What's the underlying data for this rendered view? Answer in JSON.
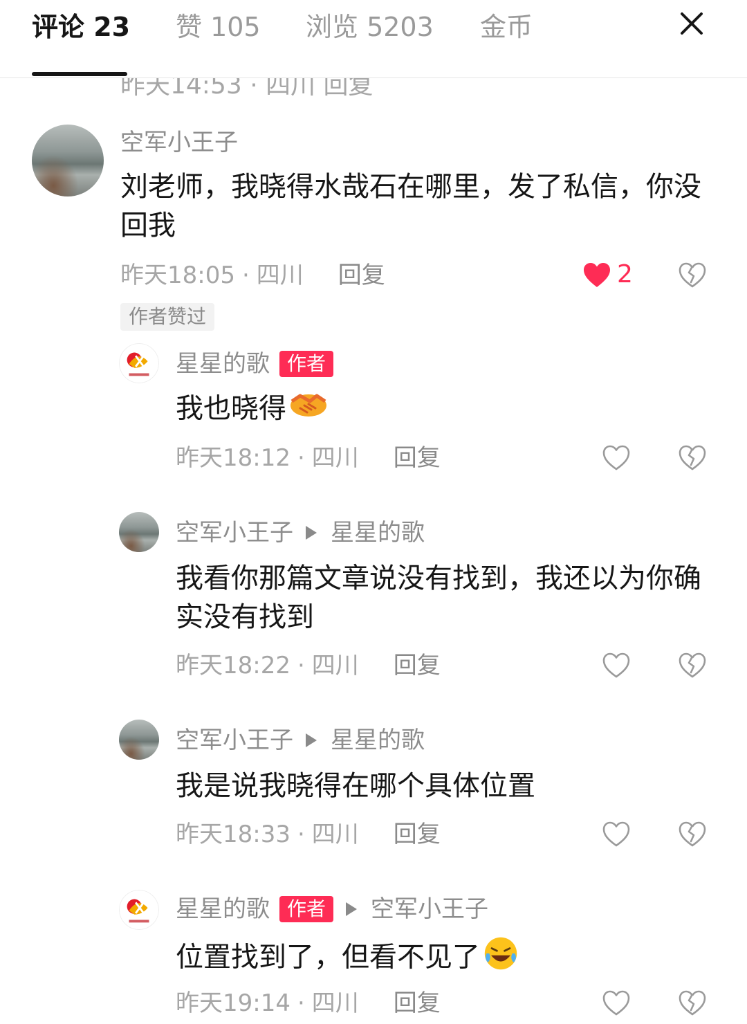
{
  "header": {
    "tabs": [
      {
        "label": "评论 23"
      },
      {
        "label": "赞 105"
      },
      {
        "label": "浏览 5203"
      },
      {
        "label": "金币"
      }
    ]
  },
  "previous_meta": "昨天14:53 · 四川 回复",
  "comments": [
    {
      "user": "空军小王子",
      "text": "刘老师，我晓得水哉石在哪里，发了私信，你没回我",
      "time": "昨天18:05",
      "location": "四川",
      "reply_label": "回复",
      "like_count": "2",
      "author_liked_tag": "作者赞过"
    },
    {
      "user": "星星的歌",
      "badge": "作者",
      "text": "我也晓得",
      "emoji": "handshake",
      "time": "昨天18:12",
      "location": "四川",
      "reply_label": "回复"
    },
    {
      "user": "空军小王子",
      "reply_to": "星星的歌",
      "text": "我看你那篇文章说没有找到，我还以为你确实没有找到",
      "time": "昨天18:22",
      "location": "四川",
      "reply_label": "回复"
    },
    {
      "user": "空军小王子",
      "reply_to": "星星的歌",
      "text": "我是说我晓得在哪个具体位置",
      "time": "昨天18:33",
      "location": "四川",
      "reply_label": "回复"
    },
    {
      "user": "星星的歌",
      "badge": "作者",
      "reply_to": "空军小王子",
      "text": "位置找到了，但看不见了",
      "emoji": "laughing-crying",
      "time": "昨天19:14",
      "location": "四川",
      "reply_label": "回复"
    }
  ],
  "colors": {
    "accent": "#fe2c55",
    "secondary_text": "#8d8d8d",
    "meta_text": "#a6a6a6"
  }
}
